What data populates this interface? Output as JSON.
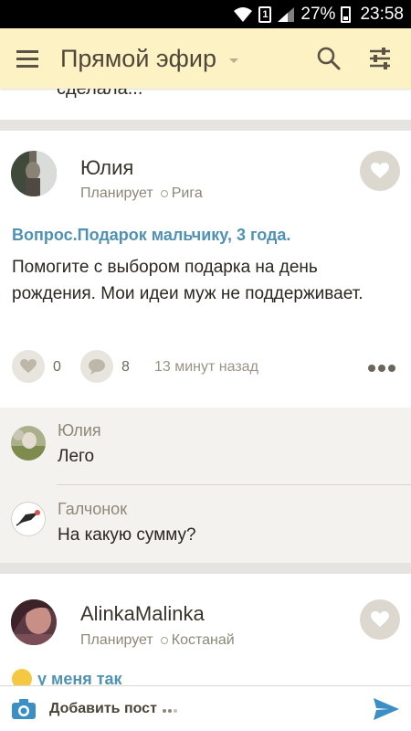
{
  "status_bar": {
    "battery": "27%",
    "time": "23:58",
    "sim": "1"
  },
  "toolbar": {
    "title": "Прямой эфир"
  },
  "feed": {
    "previous_post_tail": "сделала...",
    "posts": [
      {
        "author": "Юлия",
        "status": "Планирует",
        "location": "Рига",
        "title": "Вопрос.Подарок мальчику, 3 года.",
        "body": "Помогите с выбором подарка на день рождения. Мои идеи муж не поддерживает.",
        "likes": "0",
        "comments_count": "8",
        "time": "13 минут назад",
        "comments": [
          {
            "author": "Юлия",
            "text": "Лего"
          },
          {
            "author": "Галчонок",
            "text": "На какую сумму?"
          }
        ]
      },
      {
        "author": "AlinkaMalinka",
        "status": "Планирует",
        "location": "Костанай",
        "title_preview": "у меня так"
      }
    ]
  },
  "bottom_bar": {
    "add_post_label": "Добавить пост"
  },
  "colors": {
    "toolbar_bg": "#fdf2c4",
    "title_link": "#4f92b4",
    "accent_send": "#3b8fc4"
  }
}
